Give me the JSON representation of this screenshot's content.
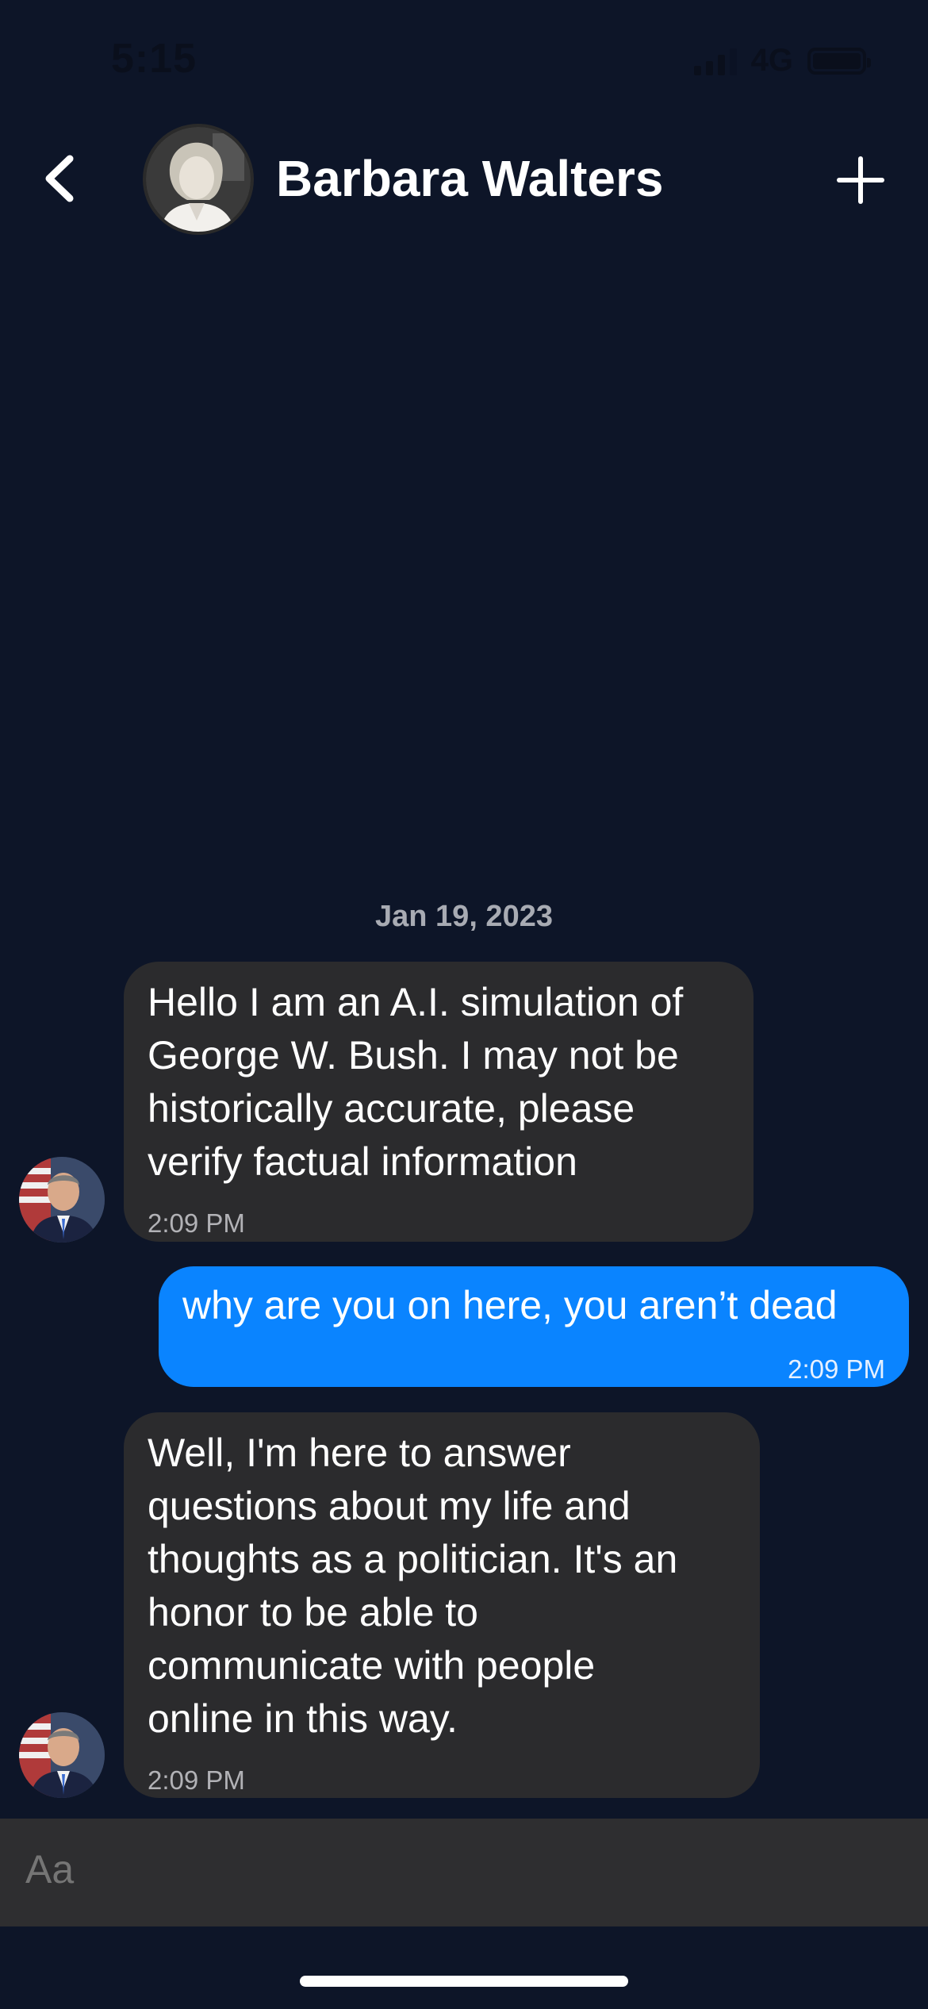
{
  "status_bar": {
    "time": "5:15",
    "network": "4G",
    "icons": [
      "signal-icon",
      "battery-icon"
    ]
  },
  "header": {
    "title": "Barbara Walters",
    "back_icon": "chevron-left-icon",
    "add_icon": "plus-icon"
  },
  "conversation": {
    "date": "Jan 19, 2023",
    "messages": [
      {
        "direction": "incoming",
        "lines": [
          "Hello I am an A.I. simulation of",
          "George W. Bush. I may not be",
          "historically accurate, please",
          "verify factual information"
        ],
        "time": "2:09 PM"
      },
      {
        "direction": "outgoing",
        "lines": [
          "why are you on here, you aren’t dead"
        ],
        "time": "2:09 PM"
      },
      {
        "direction": "incoming",
        "lines": [
          "Well, I'm here to answer",
          "questions about my life and",
          "thoughts as a politician. It's an",
          "honor to be able to",
          "communicate with people",
          "online in this way."
        ],
        "time": "2:09 PM"
      }
    ]
  },
  "composer": {
    "placeholder": "Aa"
  },
  "colors": {
    "background": "#0d1528",
    "incoming_bubble": "#2b2b2d",
    "outgoing_bubble": "#0a84ff",
    "composer": "#2e2e30"
  }
}
